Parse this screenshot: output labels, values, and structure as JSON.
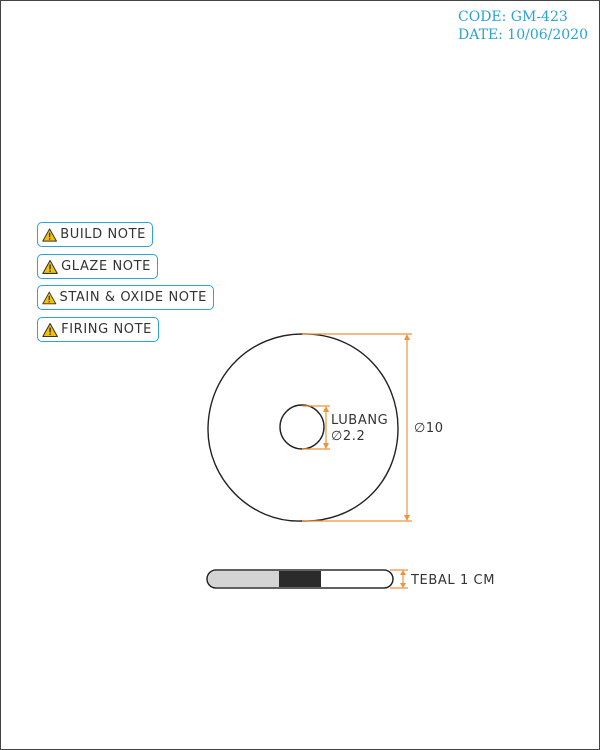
{
  "header": {
    "code": "CODE: GM-423",
    "date": "DATE: 10/06/2020"
  },
  "notes": [
    {
      "label": "BUILD NOTE",
      "icon": "warning-icon"
    },
    {
      "label": "GLAZE NOTE",
      "icon": "warning-icon"
    },
    {
      "label": "STAIN & OXIDE NOTE",
      "icon": "warning-icon"
    },
    {
      "label": "FIRING NOTE",
      "icon": "warning-icon"
    }
  ],
  "drawing": {
    "hole_label": "LUBANG",
    "hole_diameter": "∅2.2",
    "outer_diameter": "∅10",
    "thickness_label": "TEBAL 1 CM"
  },
  "colors": {
    "accent": "#29a3d8",
    "dimension": "#f0923a",
    "warning": "#f2c200",
    "glaze_light": "#d4d4d4",
    "glaze_dark": "#2b2b2b"
  }
}
